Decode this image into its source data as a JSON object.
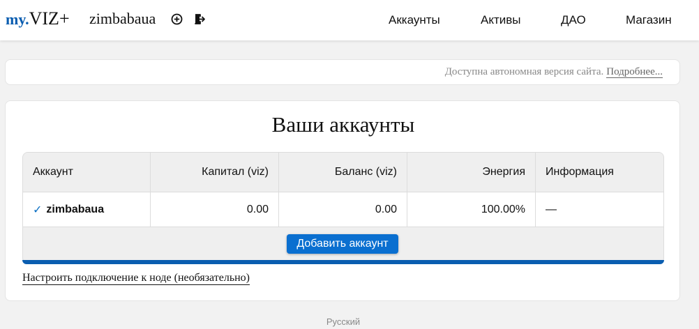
{
  "header": {
    "logo_my": "my.",
    "logo_viz": "VIZ+",
    "username": "zimbabaua",
    "icons": [
      "add-circle-icon",
      "logout-icon"
    ],
    "nav": [
      "Аккаунты",
      "Активы",
      "ДАО",
      "Магазин"
    ]
  },
  "notice": {
    "text": "Доступна автономная версия сайта.",
    "link": "Подробнее..."
  },
  "accounts": {
    "title": "Ваши аккаунты",
    "columns": [
      "Аккаунт",
      "Капитал (viz)",
      "Баланс (viz)",
      "Энергия",
      "Информация"
    ],
    "rows": [
      {
        "check_icon": "checkmark-icon",
        "account": "zimbabaua",
        "capital": "0.00",
        "balance": "0.00",
        "energy": "100.00%",
        "info": "—"
      }
    ],
    "add_button": "Добавить аккаунт",
    "node_link": "Настроить подключение к ноде (необязательно)"
  },
  "footer": {
    "language": "Русский"
  },
  "colors": {
    "accent": "#0a6fd0",
    "brand": "#0a5db0",
    "background": "#f2f2f2"
  }
}
